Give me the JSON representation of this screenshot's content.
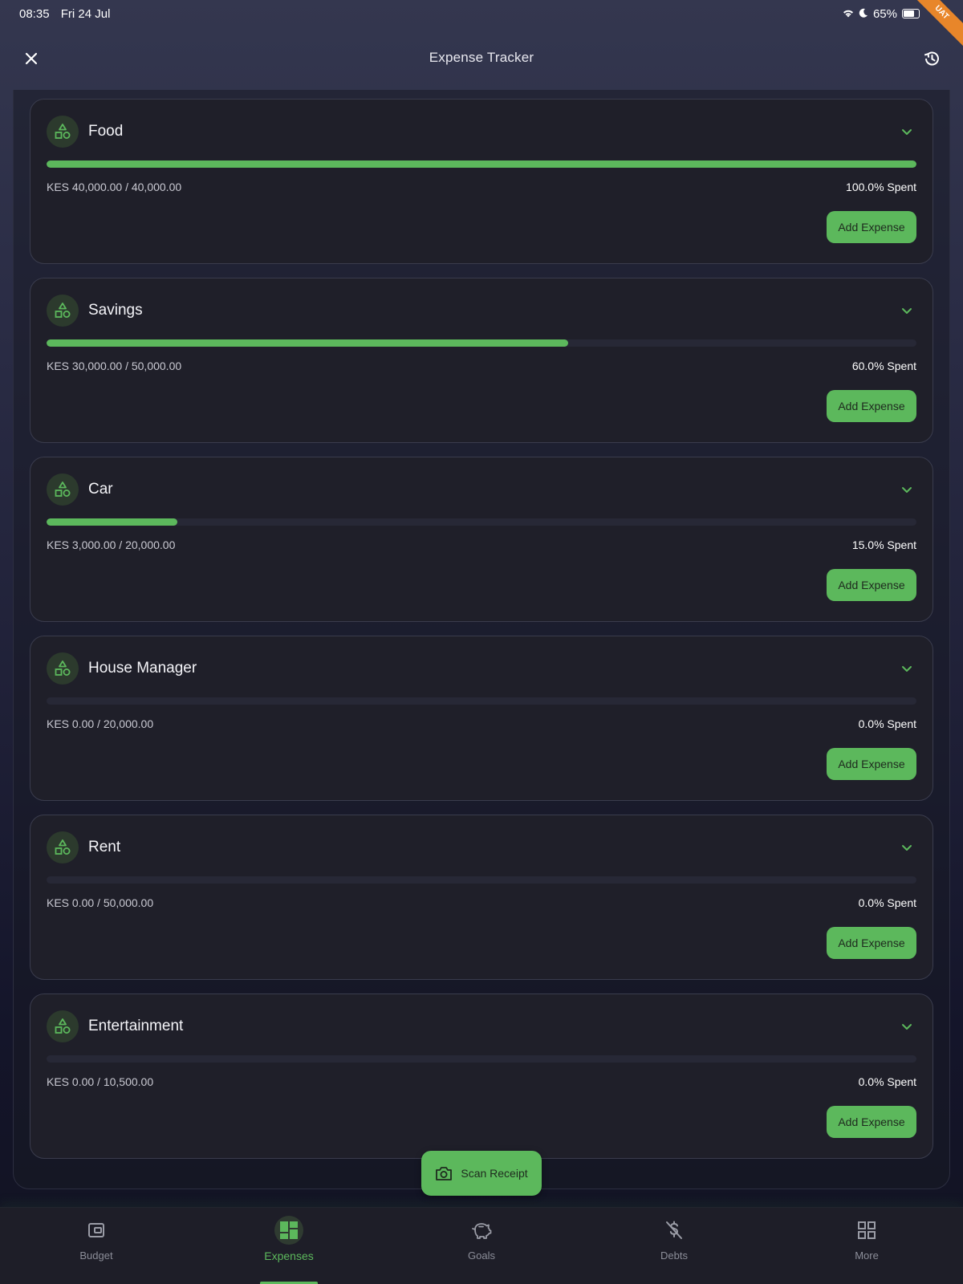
{
  "status_bar": {
    "time": "08:35",
    "date": "Fri 24 Jul",
    "battery": "65%",
    "ribbon": "UAT"
  },
  "app_bar": {
    "title": "Expense Tracker",
    "close_icon": "close-icon",
    "history_icon": "history-icon"
  },
  "categories": [
    {
      "name": "Food",
      "amount": "KES 40,000.00 / 40,000.00",
      "percent_label": "100.0% Spent",
      "progress": 1.0,
      "button": "Add Expense"
    },
    {
      "name": "Savings",
      "amount": "KES 30,000.00 / 50,000.00",
      "percent_label": "60.0% Spent",
      "progress": 0.6,
      "button": "Add Expense"
    },
    {
      "name": "Car",
      "amount": "KES 3,000.00 / 20,000.00",
      "percent_label": "15.0% Spent",
      "progress": 0.15,
      "button": "Add Expense"
    },
    {
      "name": "House Manager",
      "amount": "KES 0.00 / 20,000.00",
      "percent_label": "0.0% Spent",
      "progress": 0.0,
      "button": "Add Expense"
    },
    {
      "name": "Rent",
      "amount": "KES 0.00 / 50,000.00",
      "percent_label": "0.0% Spent",
      "progress": 0.0,
      "button": "Add Expense"
    },
    {
      "name": "Entertainment",
      "amount": "KES 0.00 / 10,500.00",
      "percent_label": "0.0% Spent",
      "progress": 0.0,
      "button": "Add Expense"
    }
  ],
  "scan_button": {
    "label": "Scan Receipt",
    "icon": "camera-icon"
  },
  "bottom_nav": [
    {
      "label": "Budget",
      "icon": "wallet-icon",
      "active": false
    },
    {
      "label": "Expenses",
      "icon": "dashboard-icon",
      "active": true
    },
    {
      "label": "Goals",
      "icon": "piggy-bank-icon",
      "active": false
    },
    {
      "label": "Debts",
      "icon": "money-off-icon",
      "active": false
    },
    {
      "label": "More",
      "icon": "grid-icon",
      "active": false
    }
  ],
  "colors": {
    "accent": "#5cb85c",
    "card_bg": "#1f1f29",
    "track": "#272836"
  }
}
